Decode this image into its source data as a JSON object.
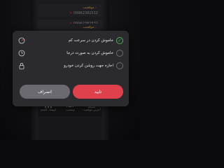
{
  "background_list": [
    {
      "status": "موقعیت :",
      "phone": "09962382532",
      "close": "×"
    },
    {
      "status": "موقعیت :",
      "phone": "09962382532",
      "close": "×"
    },
    {
      "status": "موقعیت :",
      "phone": "09962382532",
      "close": "×"
    }
  ],
  "dialog": {
    "options": [
      {
        "label": "خاموش کردن در سرعت کم",
        "checked": true,
        "icon": "check-icon",
        "leading_icon": "speedometer-icon"
      },
      {
        "label": "خاموش کردن به صورت درجا",
        "checked": false,
        "icon": "empty-circle-icon",
        "leading_icon": "clock-icon"
      },
      {
        "label": "اجازه جهت روشن کردن خودرو",
        "checked": false,
        "icon": "empty-circle-icon",
        "leading_icon": "lock-icon"
      }
    ],
    "confirm_label": "تایید",
    "cancel_label": "انصراف"
  },
  "tabbar": {
    "items": [
      {
        "label": "کوشک کلیدی",
        "icon": "keypad-icon"
      },
      {
        "label": "وضعیت",
        "icon": "car-icon"
      },
      {
        "label": "آخرین موقعیت",
        "icon": "map-icon"
      }
    ]
  },
  "colors": {
    "accent": "#e0404c",
    "check": "#4caf50",
    "status": "#e0b34a"
  }
}
